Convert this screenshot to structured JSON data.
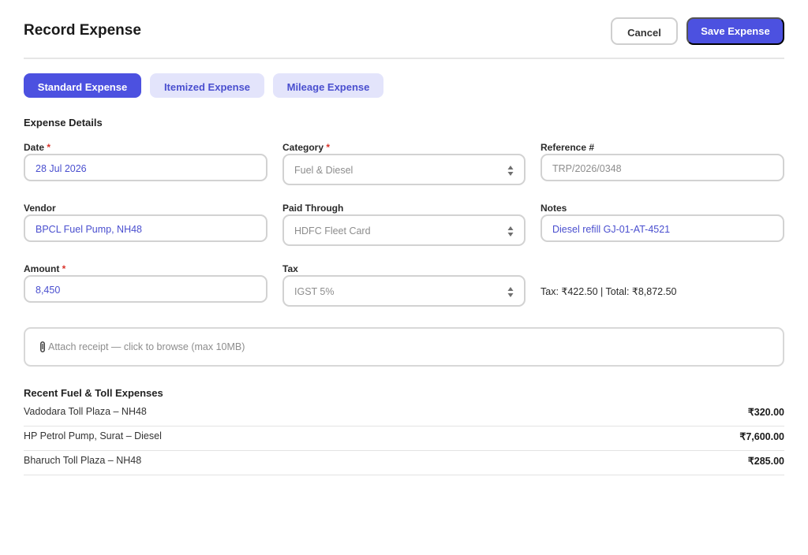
{
  "header": {
    "title": "Record Expense",
    "cancel_label": "Cancel",
    "save_label": "Save Expense"
  },
  "tabs": [
    {
      "label": "Standard Expense",
      "active": true
    },
    {
      "label": "Itemized Expense",
      "active": false
    },
    {
      "label": "Mileage Expense",
      "active": false
    }
  ],
  "details": {
    "section_title": "Expense Details",
    "date": {
      "label": "Date",
      "required": "*",
      "value": "28 Jul 2026"
    },
    "category": {
      "label": "Category",
      "required": "*",
      "value": "Fuel & Diesel"
    },
    "reference": {
      "label": "Reference #",
      "placeholder": "TRP/2026/0348"
    },
    "vendor": {
      "label": "Vendor",
      "value": "BPCL Fuel Pump, NH48"
    },
    "paid_through": {
      "label": "Paid Through",
      "value": "HDFC Fleet Card"
    },
    "notes": {
      "label": "Notes",
      "value": "Diesel refill GJ-01-AT-4521"
    },
    "amount": {
      "label": "Amount",
      "required": "*",
      "value": "8,450"
    },
    "tax": {
      "label": "Tax",
      "value": "IGST 5%"
    },
    "tax_summary": "Tax: ₹422.50 | Total: ₹8,872.50"
  },
  "attachment": {
    "icon": "paperclip-icon",
    "text": "Attach receipt — click to browse (max 10MB)"
  },
  "recent": {
    "title": "Recent Fuel & Toll Expenses",
    "items": [
      {
        "description": "Vadodara Toll Plaza – NH48",
        "amount": "₹320.00"
      },
      {
        "description": "HP Petrol Pump, Surat – Diesel",
        "amount": "₹7,600.00"
      },
      {
        "description": "Bharuch Toll Plaza – NH48",
        "amount": "₹285.00"
      }
    ]
  },
  "colors": {
    "accent": "#4c51e0",
    "accent_soft": "#e3e4fb",
    "required": "#d9332b",
    "value_text": "#4a4fcf"
  }
}
